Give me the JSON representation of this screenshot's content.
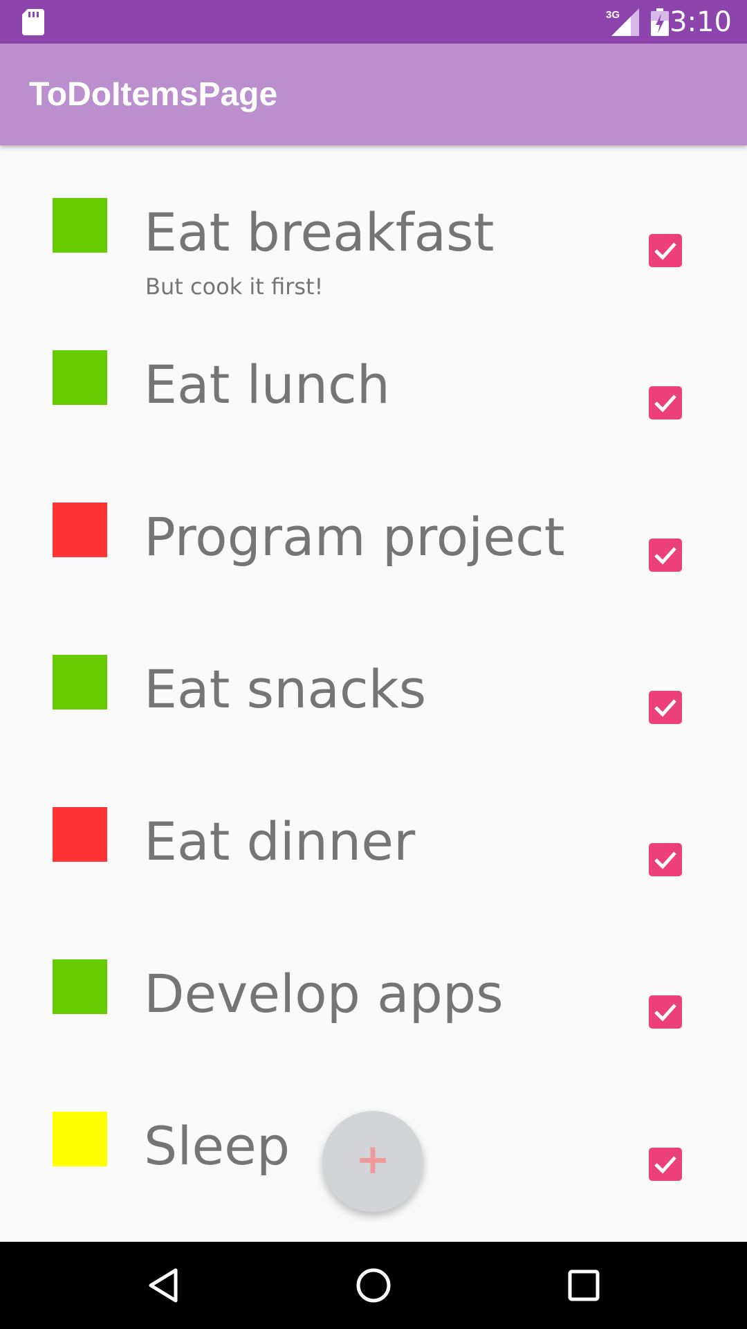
{
  "status_bar": {
    "time": "3:10",
    "network_label": "3G",
    "icons": [
      "sd-card-icon",
      "signal-icon",
      "battery-charging-icon"
    ]
  },
  "app_bar": {
    "title": "ToDoItemsPage",
    "color": "#bb8fce"
  },
  "items": [
    {
      "title": "Eat breakfast",
      "note": "But cook it first!",
      "color": "#66cc00",
      "checked": true
    },
    {
      "title": "Eat lunch",
      "note": "",
      "color": "#66cc00",
      "checked": true
    },
    {
      "title": "Program project",
      "note": "",
      "color": "#ff3333",
      "checked": true
    },
    {
      "title": "Eat snacks",
      "note": "",
      "color": "#66cc00",
      "checked": true
    },
    {
      "title": "Eat dinner",
      "note": "",
      "color": "#ff3333",
      "checked": true
    },
    {
      "title": "Develop apps",
      "note": "",
      "color": "#66cc00",
      "checked": true
    },
    {
      "title": "Sleep",
      "note": "",
      "color": "#ffff00",
      "checked": true
    }
  ],
  "fab": {
    "label": "+",
    "icon": "plus-icon"
  },
  "nav_bar": {
    "buttons": [
      "back-icon",
      "home-icon",
      "recents-icon"
    ]
  },
  "colors": {
    "status_bar": "#8e44ad",
    "checkbox": "#ec407a",
    "text": "#757575",
    "background": "#fafafa"
  }
}
